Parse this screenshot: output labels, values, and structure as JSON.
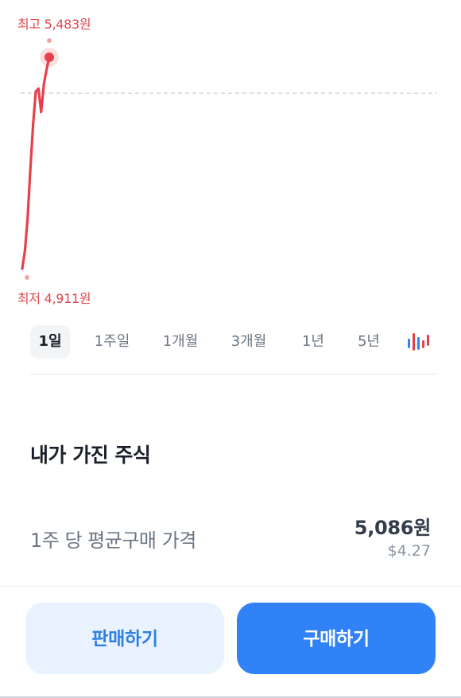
{
  "chart": {
    "high_label": "최고 5,483원",
    "low_label": "최저 4,911원",
    "line_color": "#e8404a",
    "reference_line_color": "#c8cdd2"
  },
  "chart_data": {
    "type": "line",
    "title": "",
    "xlabel": "",
    "ylabel": "",
    "ylim": [
      4911,
      5483
    ],
    "series": [
      {
        "values": [
          4911,
          4960,
          5050,
          5180,
          5300,
          5390,
          5398,
          5335,
          5410,
          5450,
          5483
        ]
      }
    ],
    "reference_value": 5386,
    "annotations": [
      "최고 5,483원",
      "최저 4,911원"
    ]
  },
  "period_tabs": {
    "items": [
      {
        "label": "1일",
        "active": true
      },
      {
        "label": "1주일",
        "active": false
      },
      {
        "label": "1개월",
        "active": false
      },
      {
        "label": "3개월",
        "active": false
      },
      {
        "label": "1년",
        "active": false
      },
      {
        "label": "5년",
        "active": false
      }
    ],
    "chart_toggle_icon": "candlestick-chart-icon"
  },
  "holdings": {
    "title": "내가 가진 주식",
    "avg_price_label": "1주 당 평균구매 가격",
    "avg_price_krw": "5,086원",
    "avg_price_usd": "$4.27"
  },
  "actions": {
    "sell_label": "판매하기",
    "buy_label": "구매하기",
    "sell_color": "#e8f3ff",
    "buy_color": "#3182f6"
  }
}
